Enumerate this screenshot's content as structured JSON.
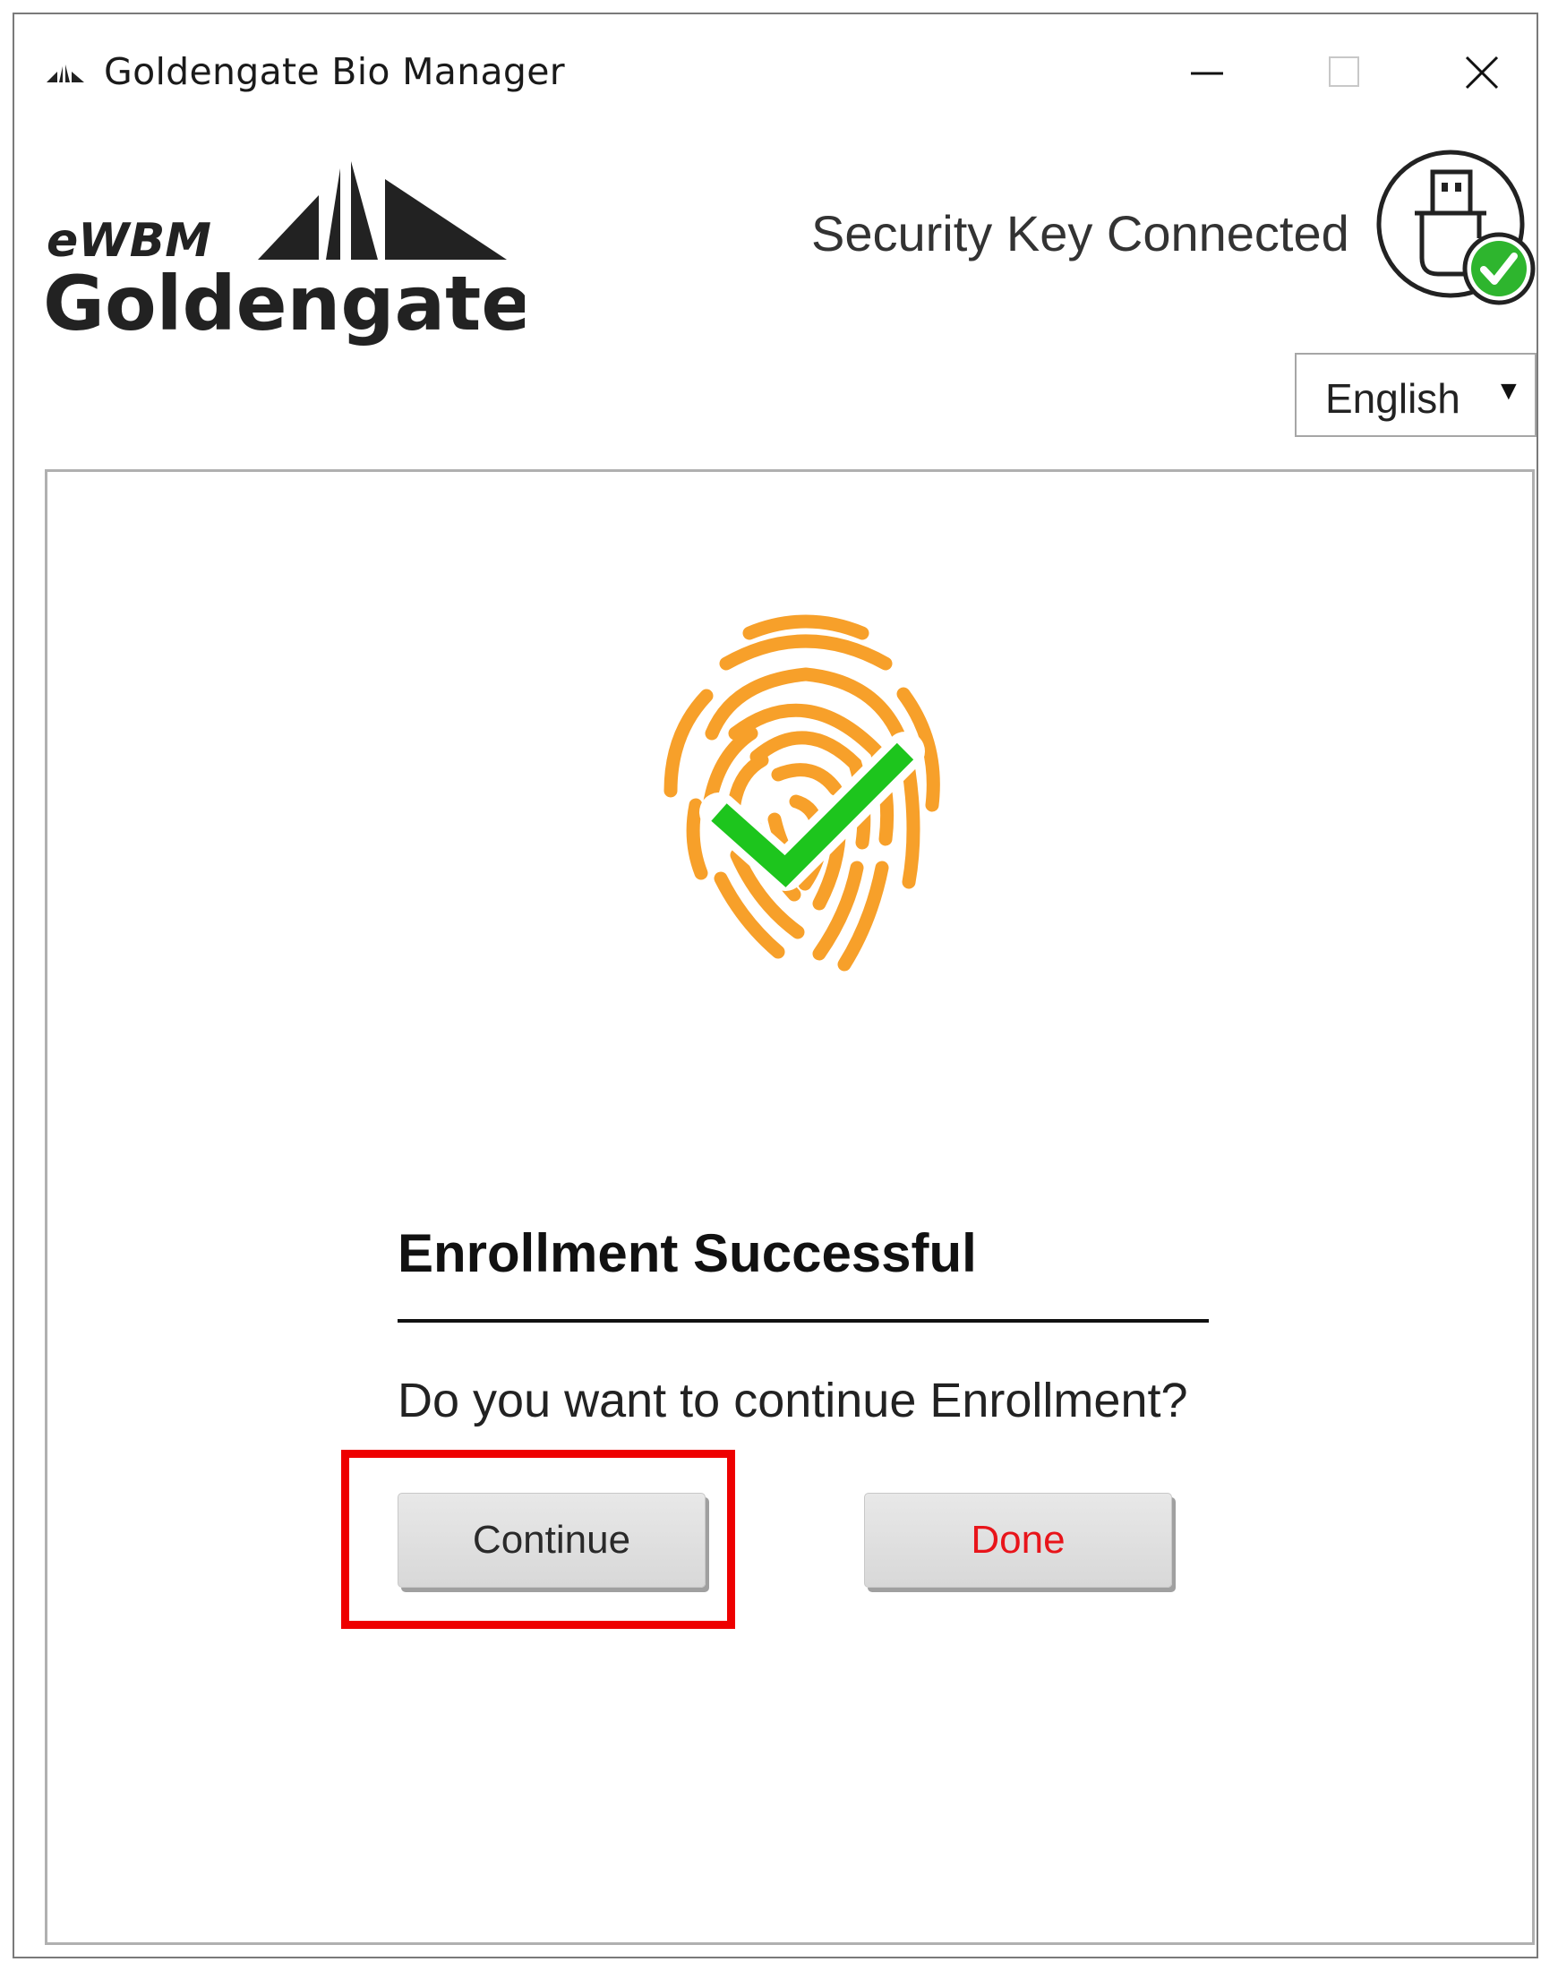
{
  "window": {
    "title": "Goldengate Bio Manager",
    "controls": [
      "minimize",
      "maximize",
      "close"
    ]
  },
  "header": {
    "logo_text": [
      "eWBM",
      "Goldengate"
    ],
    "status_text": "Security Key Connected",
    "status_icon": "usb-key-connected-icon"
  },
  "language": {
    "selected": "English",
    "arrow": "▼"
  },
  "main": {
    "icon": "fingerprint-check-icon",
    "heading": "Enrollment Successful",
    "question": "Do you want to continue Enrollment?",
    "continue_label": "Continue",
    "done_label": "Done"
  },
  "colors": {
    "fingerprint": "#F7A02A",
    "check": "#1DC51D",
    "done_text": "#E8141A",
    "highlight": "#EE0000"
  }
}
